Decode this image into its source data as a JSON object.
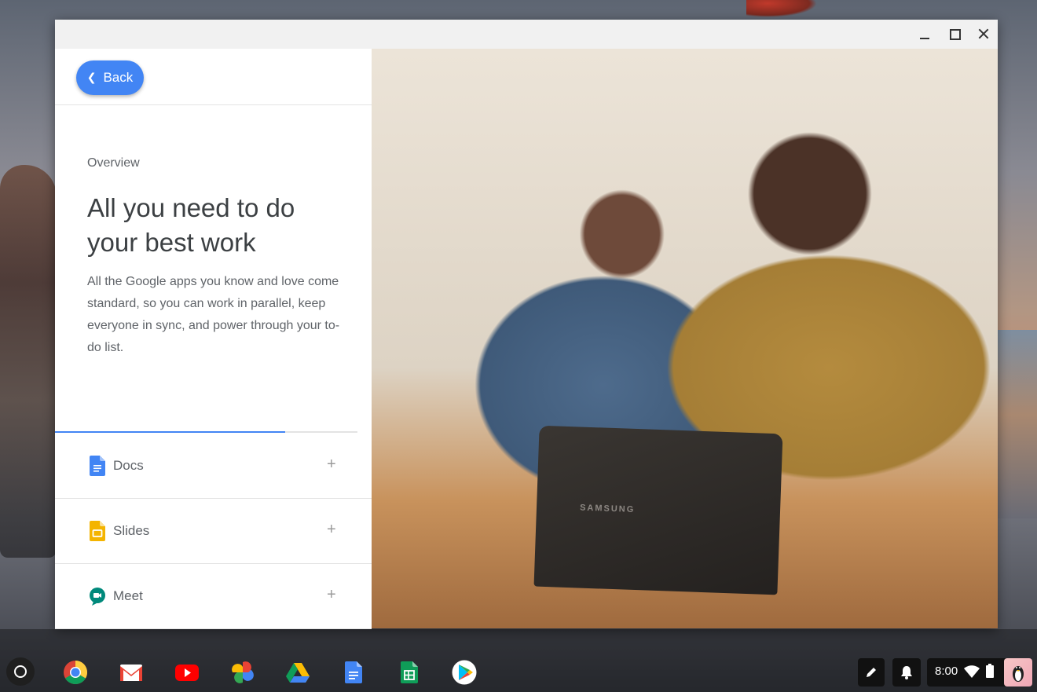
{
  "window": {
    "controls": [
      "minimize-icon",
      "maximize-icon",
      "close-icon"
    ]
  },
  "nav": {
    "back_label": "Back"
  },
  "overview": {
    "eyebrow": "Overview",
    "headline": "All you need to do your best work",
    "body": "All the Google apps you know and love come standard, so you can work in parallel, keep everyone in sync, and power through your to-do list."
  },
  "progress": {
    "fraction": 0.76,
    "accent": "#4285f4"
  },
  "apps": [
    {
      "label": "Docs",
      "icon": "docs-icon",
      "color": "#4285f4",
      "expand": "+"
    },
    {
      "label": "Slides",
      "icon": "slides-icon",
      "color": "#f4b400",
      "expand": "+"
    },
    {
      "label": "Meet",
      "icon": "meet-icon",
      "color": "#00897b",
      "expand": "+"
    }
  ],
  "hero": {
    "laptop_brand": "SAMSUNG"
  },
  "shelf": {
    "apps": [
      "chrome-icon",
      "gmail-icon",
      "youtube-icon",
      "photos-icon",
      "drive-icon",
      "docs-icon",
      "sheets-icon",
      "play-store-icon"
    ]
  },
  "tray": {
    "time": "8:00",
    "icons": [
      "stylus-icon",
      "notification-icon",
      "wifi-icon",
      "battery-icon",
      "avatar"
    ]
  }
}
